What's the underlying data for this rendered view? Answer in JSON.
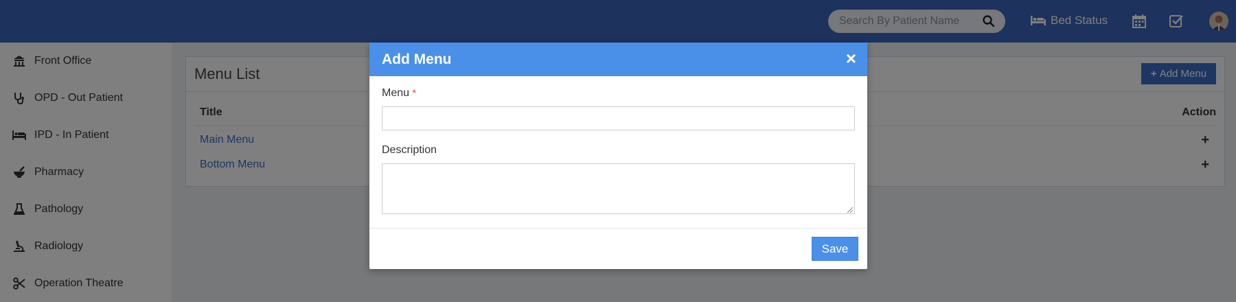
{
  "header": {
    "search_placeholder": "Search By Patient Name",
    "bed_status_label": "Bed Status"
  },
  "sidebar": {
    "items": [
      {
        "label": "Front Office",
        "icon": "front-office-icon"
      },
      {
        "label": "OPD - Out Patient",
        "icon": "stethoscope-icon"
      },
      {
        "label": "IPD - In Patient",
        "icon": "bed-icon"
      },
      {
        "label": "Pharmacy",
        "icon": "mortar-pestle-icon"
      },
      {
        "label": "Pathology",
        "icon": "flask-icon"
      },
      {
        "label": "Radiology",
        "icon": "microscope-icon"
      },
      {
        "label": "Operation Theatre",
        "icon": "scissors-icon"
      }
    ]
  },
  "panel": {
    "title": "Menu List",
    "add_button_label": "Add Menu",
    "columns": [
      "Title",
      "Action"
    ],
    "rows": [
      {
        "title": "Main Menu",
        "action": "+"
      },
      {
        "title": "Bottom Menu",
        "action": "+"
      }
    ]
  },
  "modal": {
    "title": "Add Menu",
    "close_label": "×",
    "menu_label": "Menu",
    "required_mark": "*",
    "menu_value": "",
    "description_label": "Description",
    "description_value": "",
    "save_label": "Save"
  },
  "colors": {
    "header_bg": "#3a64b8",
    "modal_header_bg": "#4a90e8",
    "link": "#3c6cc4"
  }
}
